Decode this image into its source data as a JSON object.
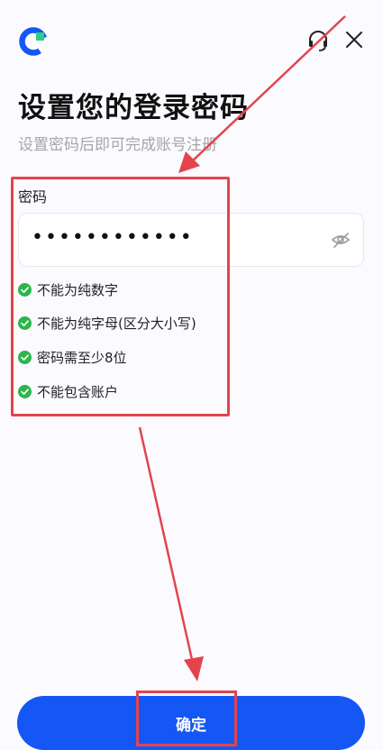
{
  "header": {
    "logo_icon": "app-logo-icon",
    "support_icon": "headset-icon",
    "close_icon": "close-icon"
  },
  "page": {
    "title": "设置您的登录密码",
    "subtitle": "设置密码后即可完成账号注册"
  },
  "password": {
    "label": "密码",
    "value": "••••••••••••",
    "visibility_icon": "eye-off-icon"
  },
  "rules": [
    {
      "text": "不能为纯数字",
      "status": "met"
    },
    {
      "text": "不能为纯字母(区分大小写)",
      "status": "met"
    },
    {
      "text": "密码需至少8位",
      "status": "met"
    },
    {
      "text": "不能包含账户",
      "status": "met"
    }
  ],
  "actions": {
    "confirm_label": "确定"
  },
  "colors": {
    "primary": "#1457f5",
    "check": "#2bb64a",
    "annotation": "#e3444c",
    "background": "#fbfaff"
  }
}
